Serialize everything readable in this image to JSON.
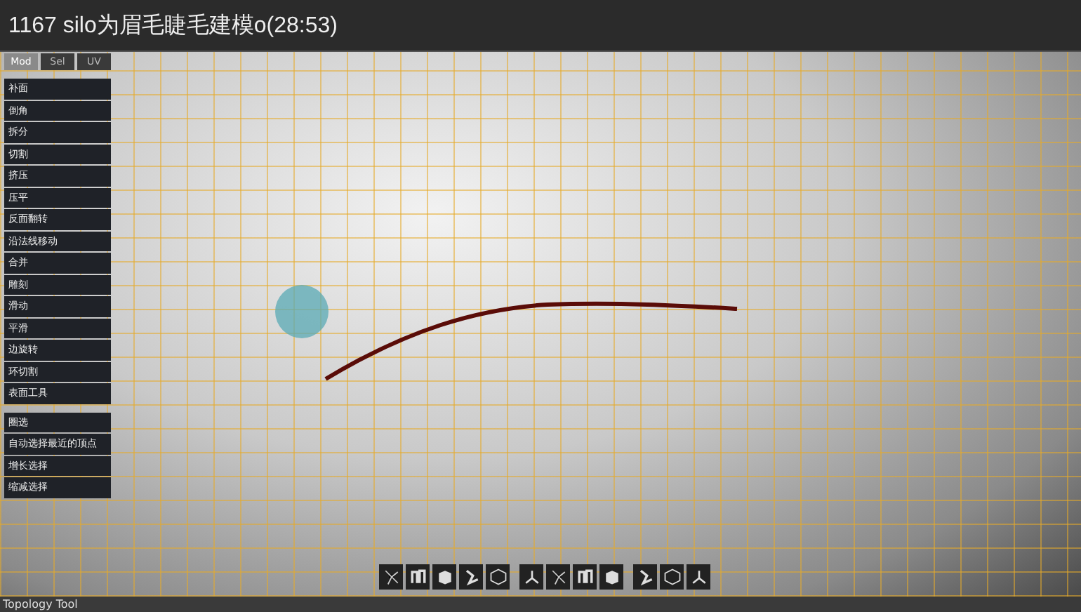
{
  "window": {
    "title": "1167 silo为眉毛睫毛建模o(28:53)"
  },
  "tool_panel": {
    "tabs": [
      {
        "label": "Mod",
        "selected": true
      },
      {
        "label": "Sel",
        "selected": false
      },
      {
        "label": "UV",
        "selected": false
      }
    ],
    "groups": [
      [
        "补面",
        "倒角",
        "拆分",
        "切割",
        "挤压",
        "压平",
        "反面翻转",
        "沿法线移动",
        "合并",
        "雕刻",
        "滑动",
        "平滑",
        "边旋转",
        "环切割",
        "表面工具"
      ],
      [
        "圈选",
        "自动选择最近的顶点",
        "增长选择",
        "缩减选择"
      ]
    ]
  },
  "status_bar": {
    "text": "Topology Tool"
  }
}
